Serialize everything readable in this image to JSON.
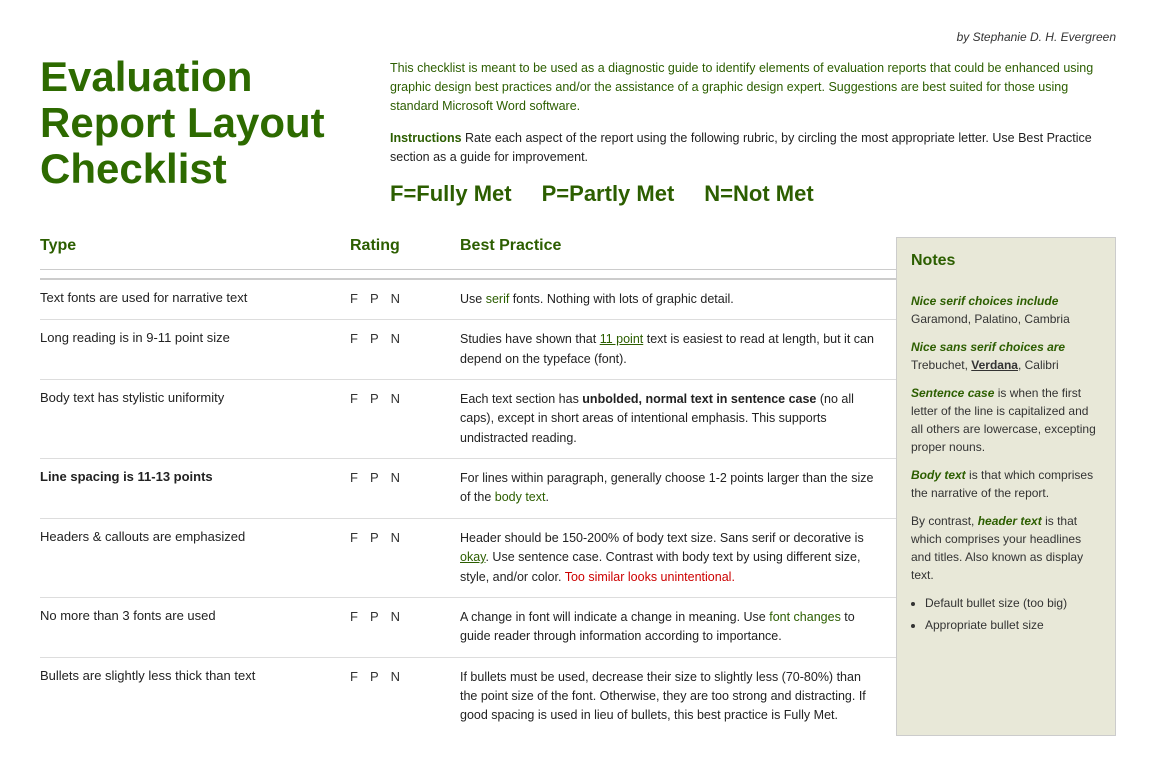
{
  "byline": "by Stephanie D. H. Evergreen",
  "title": "Evaluation\nReport Layout\nChecklist",
  "intro": "This checklist is meant to be used as a diagnostic guide to identify elements of evaluation reports that could be enhanced using graphic design best practices and/or the assistance of a graphic design expert. Suggestions are best suited for those using standard Microsoft Word software.",
  "instructions_label": "Instructions",
  "instructions_text": " Rate each aspect of the report using the following rubric, by circling the most appropriate letter. Use Best Practice section as a guide for improvement.",
  "rubric": [
    {
      "label": "F=Fully Met"
    },
    {
      "label": "P=Partly Met"
    },
    {
      "label": "N=Not Met"
    }
  ],
  "headers": {
    "type": "Type",
    "rating": "Rating",
    "best_practice": "Best Practice",
    "notes": "Notes"
  },
  "rows": [
    {
      "type": "Text fonts are used for narrative text",
      "rating": [
        "F",
        "P",
        "N"
      ],
      "practice": "Use serif fonts. Nothing with lots of graphic detail."
    },
    {
      "type": "Long reading is in 9-11 point size",
      "rating": [
        "F",
        "P",
        "N"
      ],
      "practice": "Studies have shown that 11 point text is easiest to read at length, but it can depend on the typeface (font)."
    },
    {
      "type": "Body text has stylistic uniformity",
      "rating": [
        "F",
        "P",
        "N"
      ],
      "practice": "Each text section has unbolded, normal text in sentence case (no all caps), except in short areas of intentional emphasis. This supports undistracted reading."
    },
    {
      "type": "Line spacing is 11-13 points",
      "rating": [
        "F",
        "P",
        "N"
      ],
      "practice": "For lines within paragraph, generally choose 1-2 points larger than the size of the body text."
    },
    {
      "type": "Headers & callouts are emphasized",
      "rating": [
        "F",
        "P",
        "N"
      ],
      "practice": "Header should be 150-200% of body text size. Sans serif or decorative is okay. Use sentence case. Contrast with body text by using different size, style, and/or color. Too similar looks unintentional."
    },
    {
      "type": "No more than 3 fonts are used",
      "rating": [
        "F",
        "P",
        "N"
      ],
      "practice": "A change in font will indicate a change in meaning. Use font changes to guide reader through information according to importance."
    },
    {
      "type": "Bullets are slightly less thick than text",
      "rating": [
        "F",
        "P",
        "N"
      ],
      "practice": "If bullets must be used, decrease their size to slightly less (70-80%) than the point size of the font. Otherwise, they are too strong and distracting. If good spacing is used in lieu of bullets, this best practice is Fully Met."
    }
  ],
  "notes": {
    "serif_label": "Nice serif choices include",
    "serif_fonts": "Garamond, Palatino, Cambria",
    "sans_serif_label": "Nice sans serif choices are",
    "sans_serif_fonts_normal": "Trebuchet, ",
    "sans_serif_fonts_bold": "Verdana",
    "sans_serif_fonts_end": ", Calibri",
    "sentence_case_label": "Sentence case",
    "sentence_case_text": " is when the first letter of the line is capitalized and all others are lowercase, excepting proper nouns.",
    "body_text_label": "Body text",
    "body_text_content": " is that which comprises the narrative of the report.",
    "header_text_intro": "By contrast, ",
    "header_text_label": "header text",
    "header_text_content": " is that which comprises your headlines and titles. Also known as display text.",
    "bullets": [
      "Default bullet size (too big)",
      "Appropriate bullet size"
    ]
  }
}
